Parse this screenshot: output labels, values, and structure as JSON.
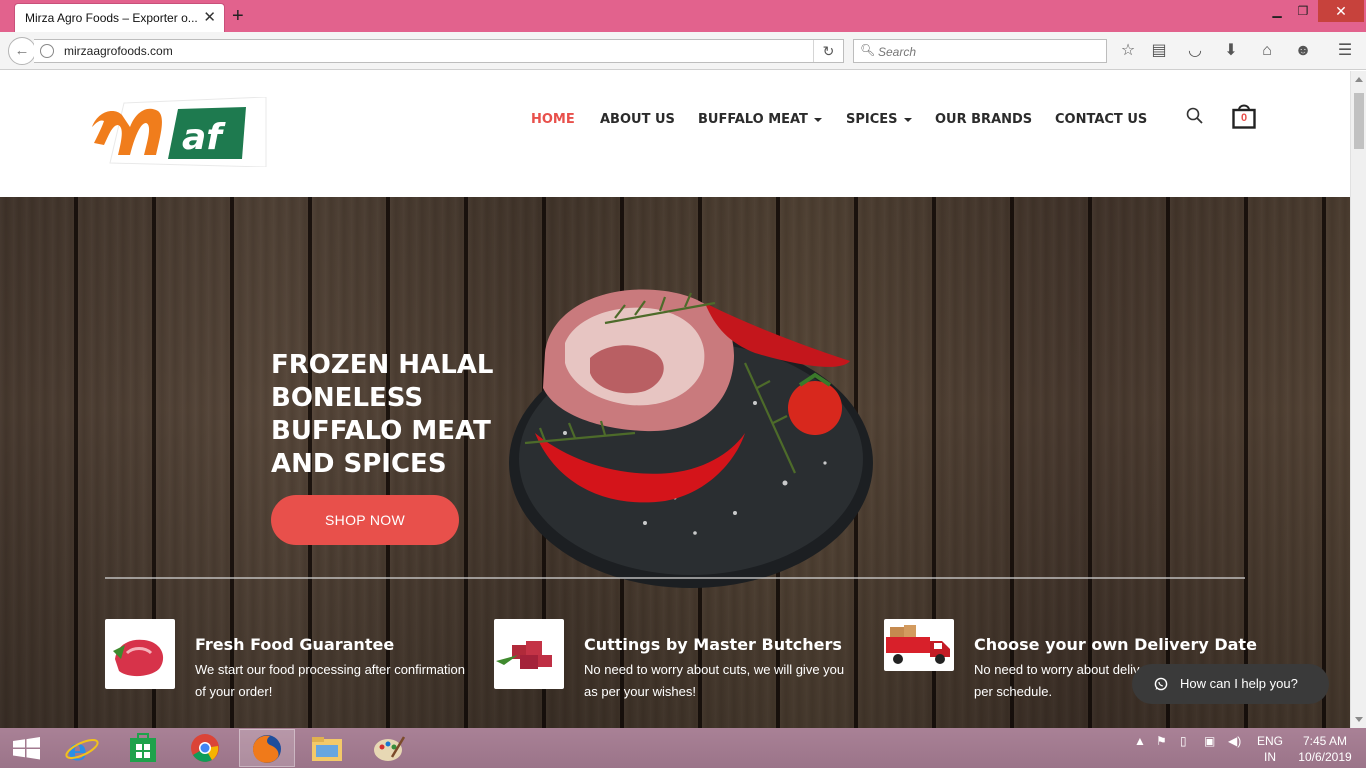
{
  "browser": {
    "tab_title": "Mirza Agro Foods – Exporter o...",
    "url": "mirzaagrofoods.com",
    "search_placeholder": "Search"
  },
  "site": {
    "logo_text": "Maf",
    "brand_colors": {
      "orange": "#f07d1c",
      "green": "#1e7a4f",
      "accent": "#e8504b"
    },
    "menu": [
      {
        "label": "HOME",
        "active": true
      },
      {
        "label": "ABOUT US"
      },
      {
        "label": "BUFFALO MEAT",
        "dropdown": true
      },
      {
        "label": "SPICES",
        "dropdown": true
      },
      {
        "label": "OUR BRANDS"
      },
      {
        "label": "CONTACT US"
      }
    ],
    "cart_count": "0"
  },
  "hero": {
    "title": "FROZEN HALAL BONELESS BUFFALO MEAT AND SPICES",
    "cta": "SHOP NOW"
  },
  "features": [
    {
      "title": "Fresh Food Guarantee",
      "desc": "We start our food processing after confirmation of your order!",
      "icon": "meat-icon"
    },
    {
      "title": "Cuttings by Master Butchers",
      "desc": "No need to worry about cuts, we will give you as per your wishes!",
      "icon": "meat-cubes-icon"
    },
    {
      "title": "Choose your own Delivery Date",
      "desc": "No need to worry about delivery, delivery as per schedule.",
      "icon": "delivery-truck-icon"
    }
  ],
  "chat": {
    "label": "How can I help you?"
  },
  "taskbar": {
    "lang_top": "ENG",
    "lang_bottom": "IN",
    "time": "7:45 AM",
    "date": "10/6/2019"
  }
}
